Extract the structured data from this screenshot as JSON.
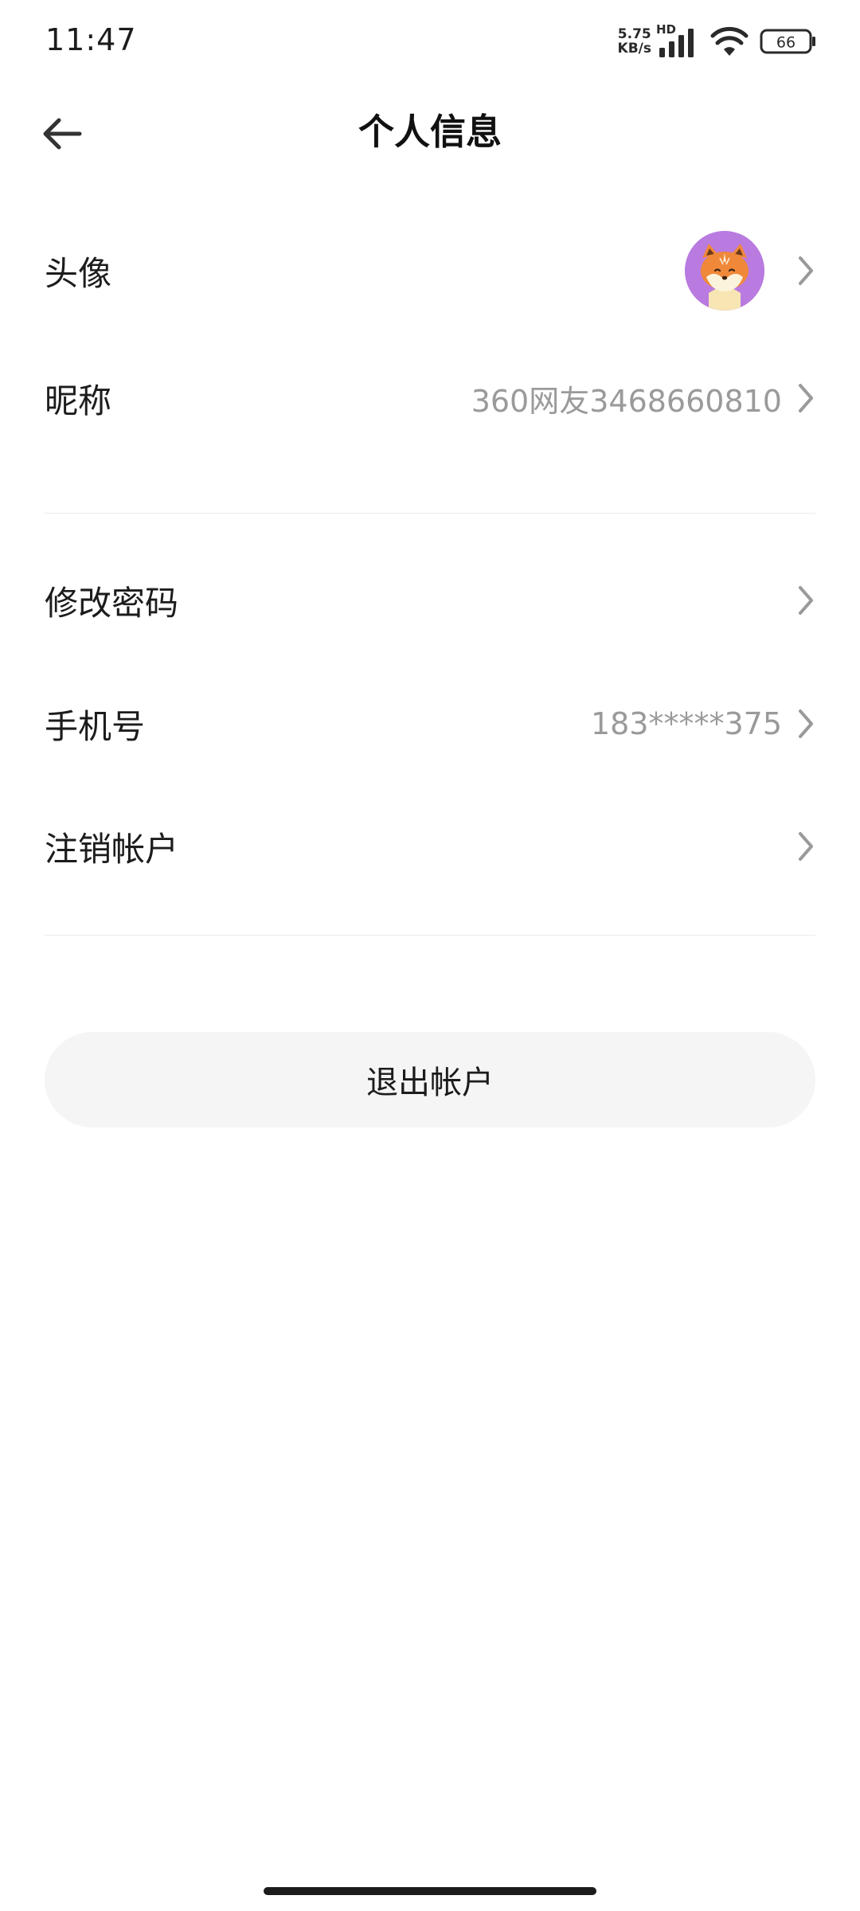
{
  "status_bar": {
    "time": "11:47",
    "net_speed_value": "5.75",
    "net_speed_unit": "KB/s",
    "network_label": "HD",
    "battery": "66"
  },
  "header": {
    "title": "个人信息"
  },
  "profile": {
    "avatar_label": "头像",
    "nickname_label": "昵称",
    "nickname_value": "360网友3468660810"
  },
  "security": {
    "change_password_label": "修改密码",
    "phone_label": "手机号",
    "phone_value": "183*****375",
    "delete_account_label": "注销帐户"
  },
  "logout": {
    "label": "退出帐户"
  },
  "colors": {
    "avatar_bg": "#b97be0",
    "secondary_text": "#9a9a9a",
    "button_bg": "#f5f5f5"
  }
}
